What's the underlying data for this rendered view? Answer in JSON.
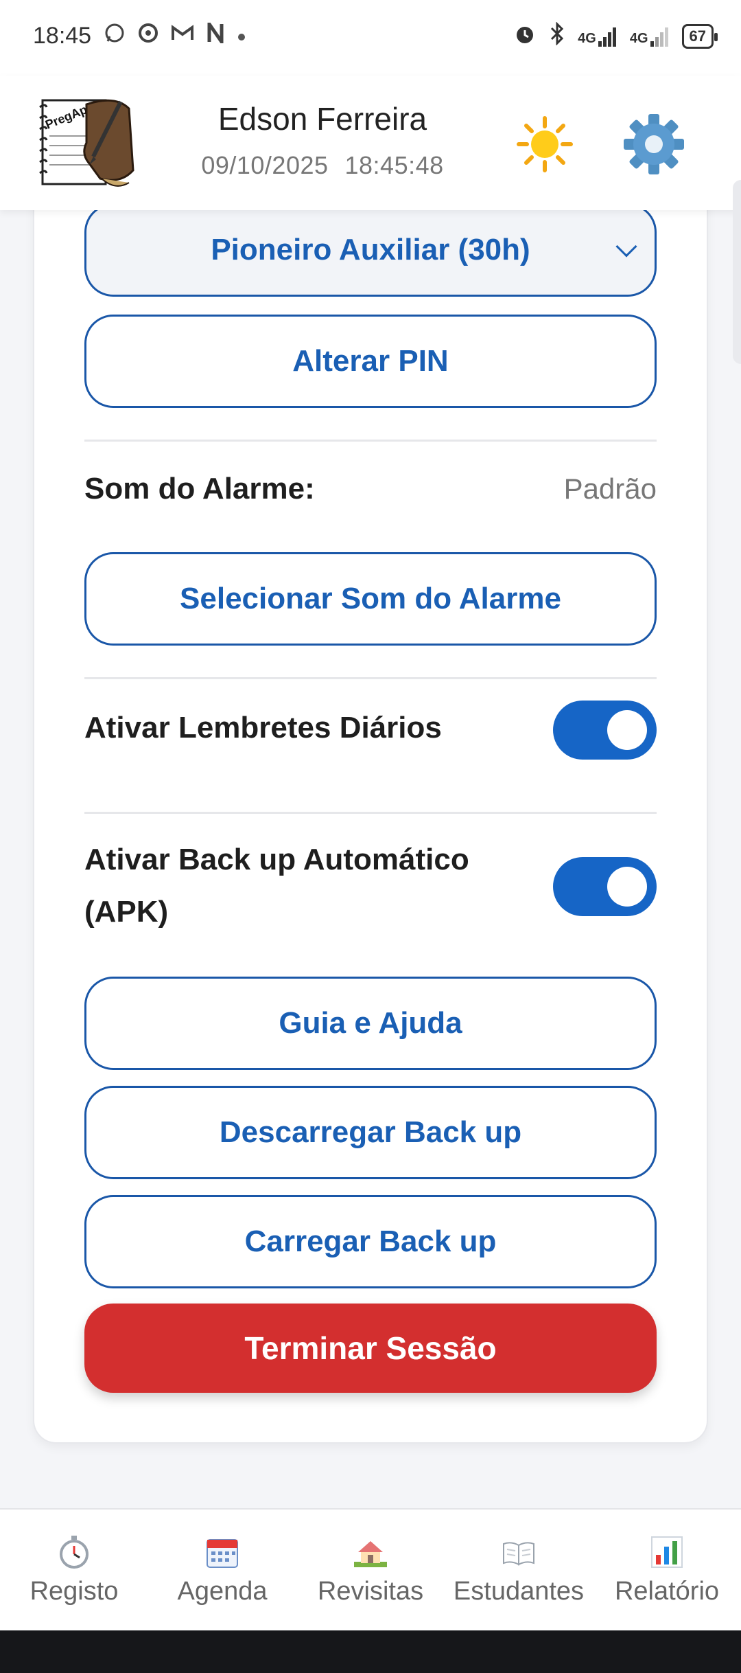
{
  "status_bar": {
    "time": "18:45",
    "notification_icons": [
      "whatsapp-icon",
      "chrome-icon",
      "gmail-icon",
      "n-app-icon",
      "dot-icon"
    ],
    "system_icons": [
      "alarm-icon",
      "bluetooth-icon",
      "signal-4g-icon",
      "signal-4g-icon"
    ],
    "network_1": "4G",
    "network_2": "4G",
    "battery": "67"
  },
  "header": {
    "logo_text": "PregApp",
    "user_name": "Edson Ferreira",
    "date": "09/10/2025",
    "time": "18:45:48",
    "theme_icon": "sun-icon",
    "settings_icon": "gear-icon"
  },
  "settings": {
    "service_type_selected": "Pioneiro Auxiliar (30h)",
    "change_pin_label": "Alterar PIN",
    "alarm_sound_label": "Som do Alarme:",
    "alarm_sound_value": "Padrão",
    "select_alarm_sound_label": "Selecionar Som do Alarme",
    "daily_reminders_label": "Ativar Lembretes Diários",
    "daily_reminders_on": true,
    "auto_backup_label_line1": "Ativar Back up Automático",
    "auto_backup_label_line2": "(APK)",
    "auto_backup_on": true,
    "guide_label": "Guia e Ajuda",
    "download_backup_label": "Descarregar Back up",
    "upload_backup_label": "Carregar Back up",
    "logout_label": "Terminar Sessão"
  },
  "colors": {
    "primary": "#1a5fb4",
    "toggle": "#1665c6",
    "danger": "#d32f2f"
  },
  "bottom_nav": [
    {
      "label": "Registo",
      "icon": "stopwatch-icon"
    },
    {
      "label": "Agenda",
      "icon": "calendar-icon"
    },
    {
      "label": "Revisitas",
      "icon": "house-icon"
    },
    {
      "label": "Estudantes",
      "icon": "book-icon"
    },
    {
      "label": "Relatório",
      "icon": "bar-chart-icon"
    }
  ]
}
